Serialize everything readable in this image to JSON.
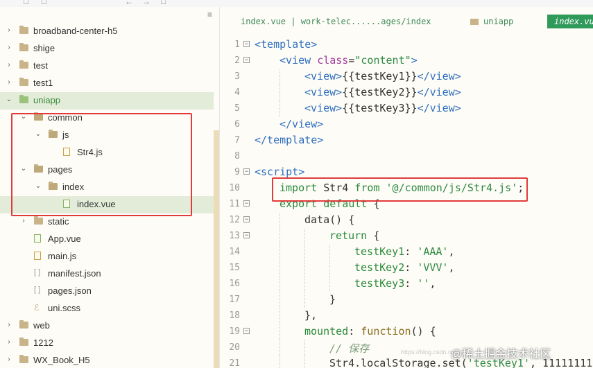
{
  "sidebar": {
    "items": [
      {
        "label": "broadband-center-h5",
        "arrow": "›",
        "icon": "folder"
      },
      {
        "label": "shige",
        "arrow": "›",
        "icon": "folder"
      },
      {
        "label": "test",
        "arrow": "›",
        "icon": "folder"
      },
      {
        "label": "test1",
        "arrow": "›",
        "icon": "folder"
      },
      {
        "label": "uniapp",
        "arrow": "⌄",
        "icon": "folder-green"
      },
      {
        "label": "common",
        "arrow": "⌄",
        "icon": "folder-open"
      },
      {
        "label": "js",
        "arrow": "⌄",
        "icon": "folder-open"
      },
      {
        "label": "Str4.js",
        "arrow": "",
        "icon": "file-js"
      },
      {
        "label": "pages",
        "arrow": "⌄",
        "icon": "folder-open"
      },
      {
        "label": "index",
        "arrow": "⌄",
        "icon": "folder-open"
      },
      {
        "label": "index.vue",
        "arrow": "",
        "icon": "file-vue"
      },
      {
        "label": "static",
        "arrow": "›",
        "icon": "folder"
      },
      {
        "label": "App.vue",
        "arrow": "",
        "icon": "file-vue"
      },
      {
        "label": "main.js",
        "arrow": "",
        "icon": "file-js"
      },
      {
        "label": "manifest.json",
        "arrow": "",
        "icon": "file-json"
      },
      {
        "label": "pages.json",
        "arrow": "",
        "icon": "file-json"
      },
      {
        "label": "uni.scss",
        "arrow": "",
        "icon": "file-scss"
      },
      {
        "label": "web",
        "arrow": "›",
        "icon": "folder"
      },
      {
        "label": "1212",
        "arrow": "›",
        "icon": "folder"
      },
      {
        "label": "WX_Book_H5",
        "arrow": "›",
        "icon": "folder"
      }
    ],
    "menu_glyph": "≡"
  },
  "tabs": {
    "breadcrumb": "index.vue | work-telec......ages/index",
    "folder": "uniapp",
    "active": "index.vue"
  },
  "editor": {
    "lines": [
      {
        "n": "1",
        "fold": "⊟",
        "indent": 0,
        "tokens": [
          [
            "c-tag",
            "<template>"
          ]
        ]
      },
      {
        "n": "2",
        "fold": "⊟",
        "indent": 1,
        "tokens": [
          [
            "c-tag",
            "<view "
          ],
          [
            "c-attr",
            "class"
          ],
          [
            "c-plain",
            "="
          ],
          [
            "c-str",
            "\"content\""
          ],
          [
            "c-tag",
            ">"
          ]
        ]
      },
      {
        "n": "3",
        "fold": "",
        "indent": 2,
        "tokens": [
          [
            "c-tag",
            "<view>"
          ],
          [
            "c-plain",
            "{{testKey1}}"
          ],
          [
            "c-tag",
            "</view>"
          ]
        ]
      },
      {
        "n": "4",
        "fold": "",
        "indent": 2,
        "tokens": [
          [
            "c-tag",
            "<view>"
          ],
          [
            "c-plain",
            "{{testKey2}}"
          ],
          [
            "c-tag",
            "</view>"
          ]
        ]
      },
      {
        "n": "5",
        "fold": "",
        "indent": 2,
        "tokens": [
          [
            "c-tag",
            "<view>"
          ],
          [
            "c-plain",
            "{{testKey3}}"
          ],
          [
            "c-tag",
            "</view>"
          ]
        ]
      },
      {
        "n": "6",
        "fold": "",
        "indent": 1,
        "tokens": [
          [
            "c-tag",
            "</view>"
          ]
        ]
      },
      {
        "n": "7",
        "fold": "",
        "indent": 0,
        "tokens": [
          [
            "c-tag",
            "</template>"
          ]
        ]
      },
      {
        "n": "8",
        "fold": "",
        "indent": 0,
        "tokens": []
      },
      {
        "n": "9",
        "fold": "⊟",
        "indent": 0,
        "tokens": [
          [
            "c-tag",
            "<script>"
          ]
        ]
      },
      {
        "n": "10",
        "fold": "",
        "indent": 1,
        "tokens": [
          [
            "c-kw",
            "import "
          ],
          [
            "c-plain",
            "Str4 "
          ],
          [
            "c-kw",
            "from "
          ],
          [
            "c-str",
            "'@/common/js/Str4.js'"
          ],
          [
            "c-plain",
            ";"
          ]
        ]
      },
      {
        "n": "11",
        "fold": "⊟",
        "indent": 1,
        "tokens": [
          [
            "c-kw",
            "export default "
          ],
          [
            "c-plain",
            "{"
          ]
        ]
      },
      {
        "n": "12",
        "fold": "⊟",
        "indent": 2,
        "tokens": [
          [
            "c-plain",
            "data() {"
          ]
        ]
      },
      {
        "n": "13",
        "fold": "⊟",
        "indent": 3,
        "tokens": [
          [
            "c-kw",
            "return "
          ],
          [
            "c-plain",
            "{"
          ]
        ]
      },
      {
        "n": "14",
        "fold": "",
        "indent": 4,
        "tokens": [
          [
            "c-kw",
            "testKey1"
          ],
          [
            "c-plain",
            ": "
          ],
          [
            "c-str",
            "'AAA'"
          ],
          [
            "c-plain",
            ","
          ]
        ]
      },
      {
        "n": "15",
        "fold": "",
        "indent": 4,
        "tokens": [
          [
            "c-kw",
            "testKey2"
          ],
          [
            "c-plain",
            ": "
          ],
          [
            "c-str",
            "'VVV'"
          ],
          [
            "c-plain",
            ","
          ]
        ]
      },
      {
        "n": "16",
        "fold": "",
        "indent": 4,
        "tokens": [
          [
            "c-kw",
            "testKey3"
          ],
          [
            "c-plain",
            ": "
          ],
          [
            "c-str",
            "''"
          ],
          [
            "c-plain",
            ","
          ]
        ]
      },
      {
        "n": "17",
        "fold": "",
        "indent": 3,
        "tokens": [
          [
            "c-plain",
            "}"
          ]
        ]
      },
      {
        "n": "18",
        "fold": "",
        "indent": 2,
        "tokens": [
          [
            "c-plain",
            "},"
          ]
        ]
      },
      {
        "n": "19",
        "fold": "⊟",
        "indent": 2,
        "tokens": [
          [
            "c-kw",
            "mounted"
          ],
          [
            "c-plain",
            ": "
          ],
          [
            "c-fn",
            "function"
          ],
          [
            "c-plain",
            "() {"
          ]
        ]
      },
      {
        "n": "20",
        "fold": "",
        "indent": 3,
        "tokens": [
          [
            "c-comment",
            "// 保存"
          ]
        ]
      },
      {
        "n": "21",
        "fold": "",
        "indent": 3,
        "tokens": [
          [
            "c-plain",
            "Str4.localStorage.set("
          ],
          [
            "c-str",
            "'testKey1'"
          ],
          [
            "c-plain",
            ", 11111111"
          ]
        ]
      }
    ]
  },
  "watermark": {
    "main": "@稀土掘金技术社区",
    "small": "https://blog.csdn.net"
  },
  "colors": {
    "highlight_box": "#e23b3b",
    "accent": "#2f9a5a"
  }
}
